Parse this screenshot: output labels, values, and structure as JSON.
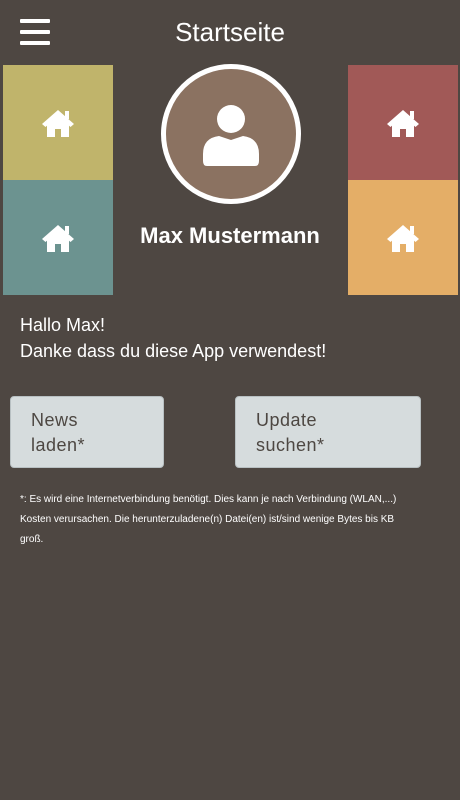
{
  "header": {
    "title": "Startseite",
    "menu_icon": "hamburger-menu-icon"
  },
  "tiles": [
    {
      "icon": "home-icon",
      "color": "#c0b46b"
    },
    {
      "icon": "home-icon",
      "color": "#6c9390"
    },
    {
      "icon": "home-icon",
      "color": "#a15957"
    },
    {
      "icon": "home-icon",
      "color": "#e4ae67"
    }
  ],
  "profile": {
    "avatar_icon": "user-icon",
    "name": "Max Mustermann"
  },
  "greeting": {
    "line1": "Hallo Max!",
    "line2": "Danke dass du diese App verwendest!"
  },
  "buttons": {
    "news": {
      "line1": "News",
      "line2": "laden*"
    },
    "update": {
      "line1": "Update",
      "line2": "suchen*"
    }
  },
  "footnote": {
    "line1": "*: Es wird eine Internetverbindung benötigt. Dies kann je nach Verbindung (WLAN,...)",
    "line2": "Kosten verursachen. Die herunterzuladene(n) Datei(en) ist/sind wenige Bytes bis KB",
    "line3": "groß."
  },
  "colors": {
    "background": "#4e4742",
    "button": "#d6dcdd",
    "avatar": "#8b7261"
  }
}
